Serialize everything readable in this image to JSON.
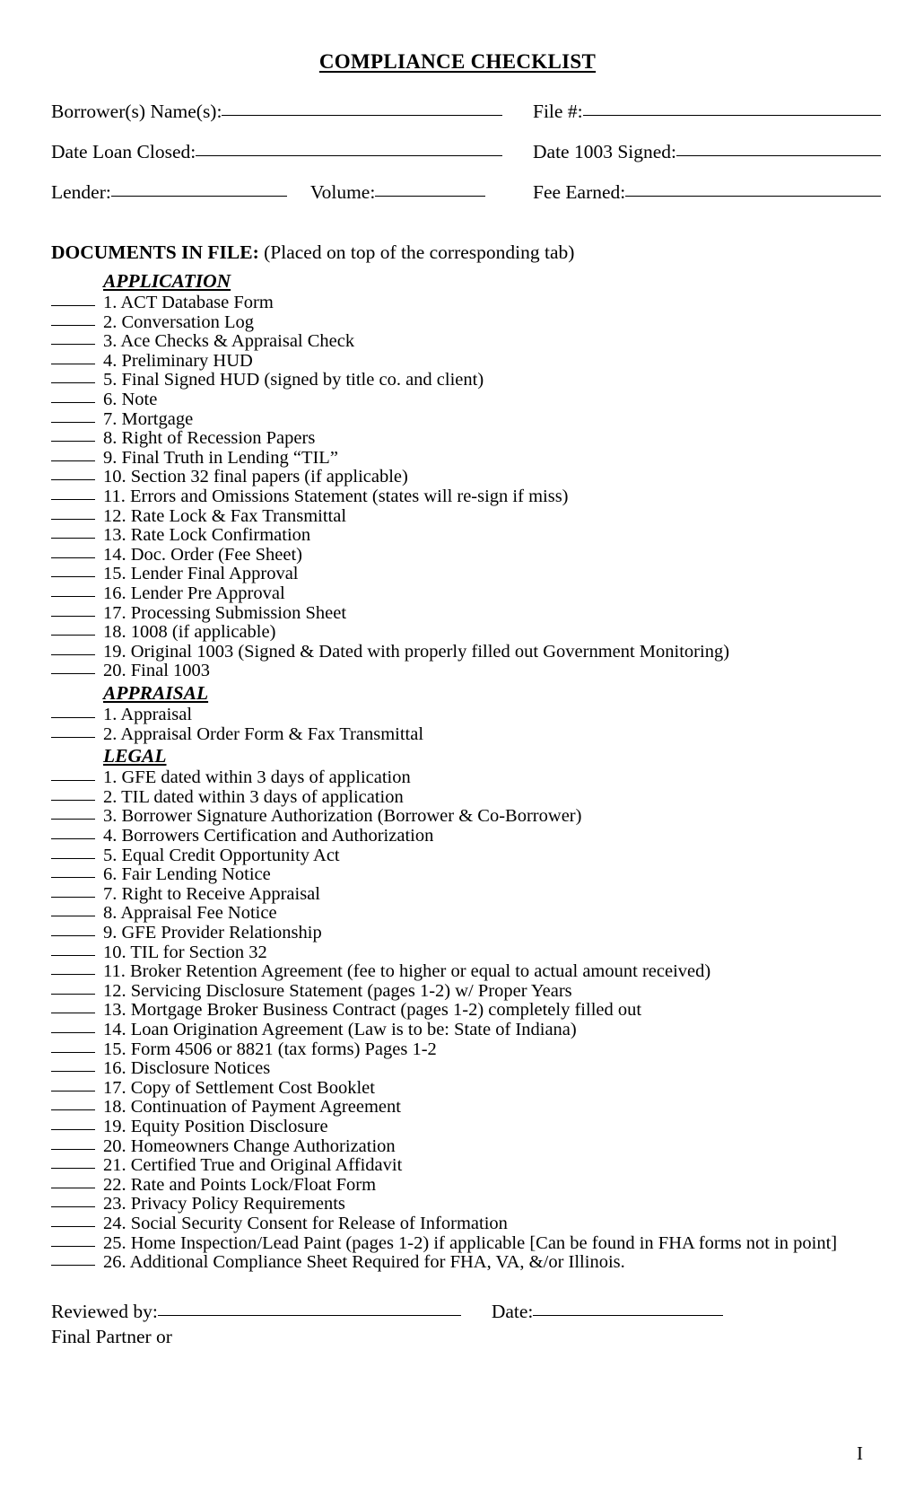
{
  "document": {
    "title": "COMPLIANCE CHECKLIST",
    "page_marker": "I"
  },
  "header_fields": {
    "borrower_names_label": "Borrower(s) Name(s):",
    "file_number_label": "File #:",
    "date_loan_closed_label": "Date Loan Closed:",
    "date_1003_signed_label": "Date 1003 Signed:",
    "lender_label": "Lender:",
    "volume_label": "Volume:",
    "fee_earned_label": "Fee Earned:",
    "borrower_names_value": "",
    "file_number_value": "",
    "date_loan_closed_value": "",
    "date_1003_signed_value": "",
    "lender_value": "",
    "volume_value": "",
    "fee_earned_value": ""
  },
  "documents_in_file": {
    "heading_bold": "DOCUMENTS IN FILE:",
    "heading_rest": " (Placed on top of the corresponding tab)",
    "sections": [
      {
        "name": "APPLICATION",
        "items": [
          "1. ACT Database Form",
          "2. Conversation Log",
          "3. Ace Checks & Appraisal Check",
          "4. Preliminary HUD",
          "5. Final Signed HUD (signed by title co. and client)",
          "6. Note",
          "7. Mortgage",
          "8. Right of Recession Papers",
          "9. Final Truth in Lending “TIL”",
          "10. Section 32 final papers (if applicable)",
          "11. Errors and Omissions Statement (states will re-sign if miss)",
          "12. Rate Lock & Fax Transmittal",
          "13. Rate Lock Confirmation",
          "14. Doc. Order (Fee Sheet)",
          "15. Lender Final Approval",
          "16. Lender Pre Approval",
          "17. Processing Submission Sheet",
          "18. 1008 (if applicable)",
          "19. Original 1003 (Signed & Dated with properly filled out Government Monitoring)",
          "20. Final 1003"
        ]
      },
      {
        "name": "APPRAISAL",
        "items": [
          "1. Appraisal",
          "2. Appraisal Order Form & Fax Transmittal"
        ]
      },
      {
        "name": "LEGAL",
        "items": [
          "1. GFE dated within 3 days of application",
          "2. TIL dated within 3 days of application",
          "3. Borrower Signature Authorization (Borrower & Co-Borrower)",
          "4. Borrowers Certification and Authorization",
          "5. Equal Credit Opportunity Act",
          "6. Fair Lending Notice",
          "7. Right to Receive Appraisal",
          "8. Appraisal Fee Notice",
          "9. GFE Provider Relationship",
          "10. TIL for Section 32",
          "11. Broker Retention Agreement (fee to higher or equal to actual amount received)",
          "12. Servicing Disclosure Statement (pages 1-2) w/ Proper Years",
          "13. Mortgage Broker Business Contract (pages 1-2) completely filled out",
          "14. Loan Origination Agreement (Law is to be: State of Indiana)",
          "15. Form 4506 or 8821 (tax forms) Pages 1-2",
          "16. Disclosure Notices",
          "17. Copy of Settlement Cost Booklet",
          "18. Continuation of Payment Agreement",
          "19. Equity Position Disclosure",
          "20. Homeowners Change Authorization",
          "21. Certified True and Original Affidavit",
          "22. Rate and Points Lock/Float Form",
          "23. Privacy Policy Requirements",
          "24. Social Security Consent for Release of Information",
          "25. Home Inspection/Lead Paint (pages 1-2) if applicable [Can be found in FHA forms not in point]",
          "26. Additional Compliance Sheet Required for FHA, VA, &/or Illinois."
        ]
      }
    ]
  },
  "footer": {
    "reviewed_by_label": "Reviewed by:",
    "reviewed_by_value": "",
    "date_label": "Date:",
    "date_value": "",
    "final_partner_label": "Final Partner or"
  }
}
